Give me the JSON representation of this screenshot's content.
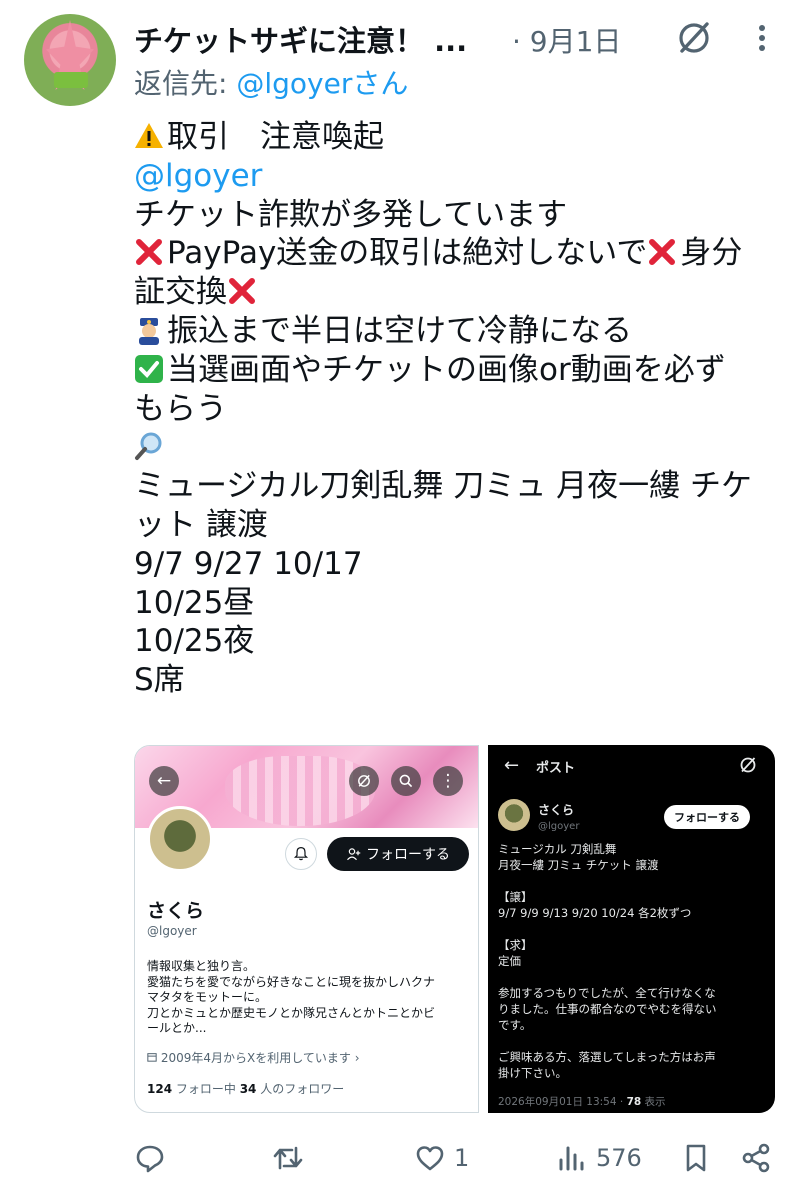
{
  "tweet": {
    "display_name": "チケットサギに注意！ ...",
    "date": "· 9月1日",
    "reply_prefix": "返信先: ",
    "reply_handle": "@lgoyer",
    "reply_suffix": "さん",
    "lines": {
      "l1": "取引　注意喚起",
      "l2": "@lgoyer",
      "l3": "チケット詐欺が多発しています",
      "l4a": "PayPay送金の取引は絶対しないで",
      "l4b": "身分",
      "l5": "証交換",
      "l6": "振込まで半日は空けて冷静になる",
      "l7": "当選画面やチケットの画像or動画を必ず",
      "l8": "もらう",
      "l10": "ミュージカル刀剣乱舞 刀ミュ 月夜一縷 チケ",
      "l11": "ット 譲渡",
      "l12": "9/7 9/27 10/17",
      "l13": "10/25昼",
      "l14": "10/25夜",
      "l15": "S席"
    }
  },
  "profile_image": {
    "follow_button": "フォローする",
    "name": "さくら",
    "handle": "@lgoyer",
    "bio": [
      "情報収集と独り言。",
      "愛猫たちを愛でながら好きなことに現を抜かしハクナ",
      "マタタをモットーに。",
      "刀とかミュとか歴史モノとか隊兄さんとかトニとかビ",
      "ールとか..."
    ],
    "joined": "2009年4月からXを利用しています",
    "following_count": "124",
    "following_label": " フォロー中  ",
    "followers_count": "34",
    "followers_label": " 人のフォロワー"
  },
  "post_image": {
    "header_title": "ポスト",
    "name": "さくら",
    "handle": "@lgoyer",
    "follow_button": "フォローする",
    "text_lines": [
      "ミュージカル 刀剣乱舞",
      "月夜一縷 刀ミュ チケット 譲渡",
      "",
      "【譲】",
      "9/7 9/9 9/13 9/20 10/24 各2枚ずつ",
      "",
      "【求】",
      "定価",
      "",
      "参加するつもりでしたが、全て行けなくな",
      "りました。仕事の都合なのでやむを得ない",
      "です。",
      "",
      "ご興味ある方、落選してしまった方はお声",
      "掛け下さい。"
    ],
    "meta_time": "2026年09月01日 13:54 · ",
    "meta_views": "78",
    "meta_views_label": " 表示"
  },
  "actions": {
    "like_count": "1",
    "views_count": "576"
  },
  "colors": {
    "accent": "#1d9bf0",
    "secondary_text": "#536471",
    "warning": "#f6b100",
    "cross": "#e0243a",
    "check": "#2fb34a"
  }
}
